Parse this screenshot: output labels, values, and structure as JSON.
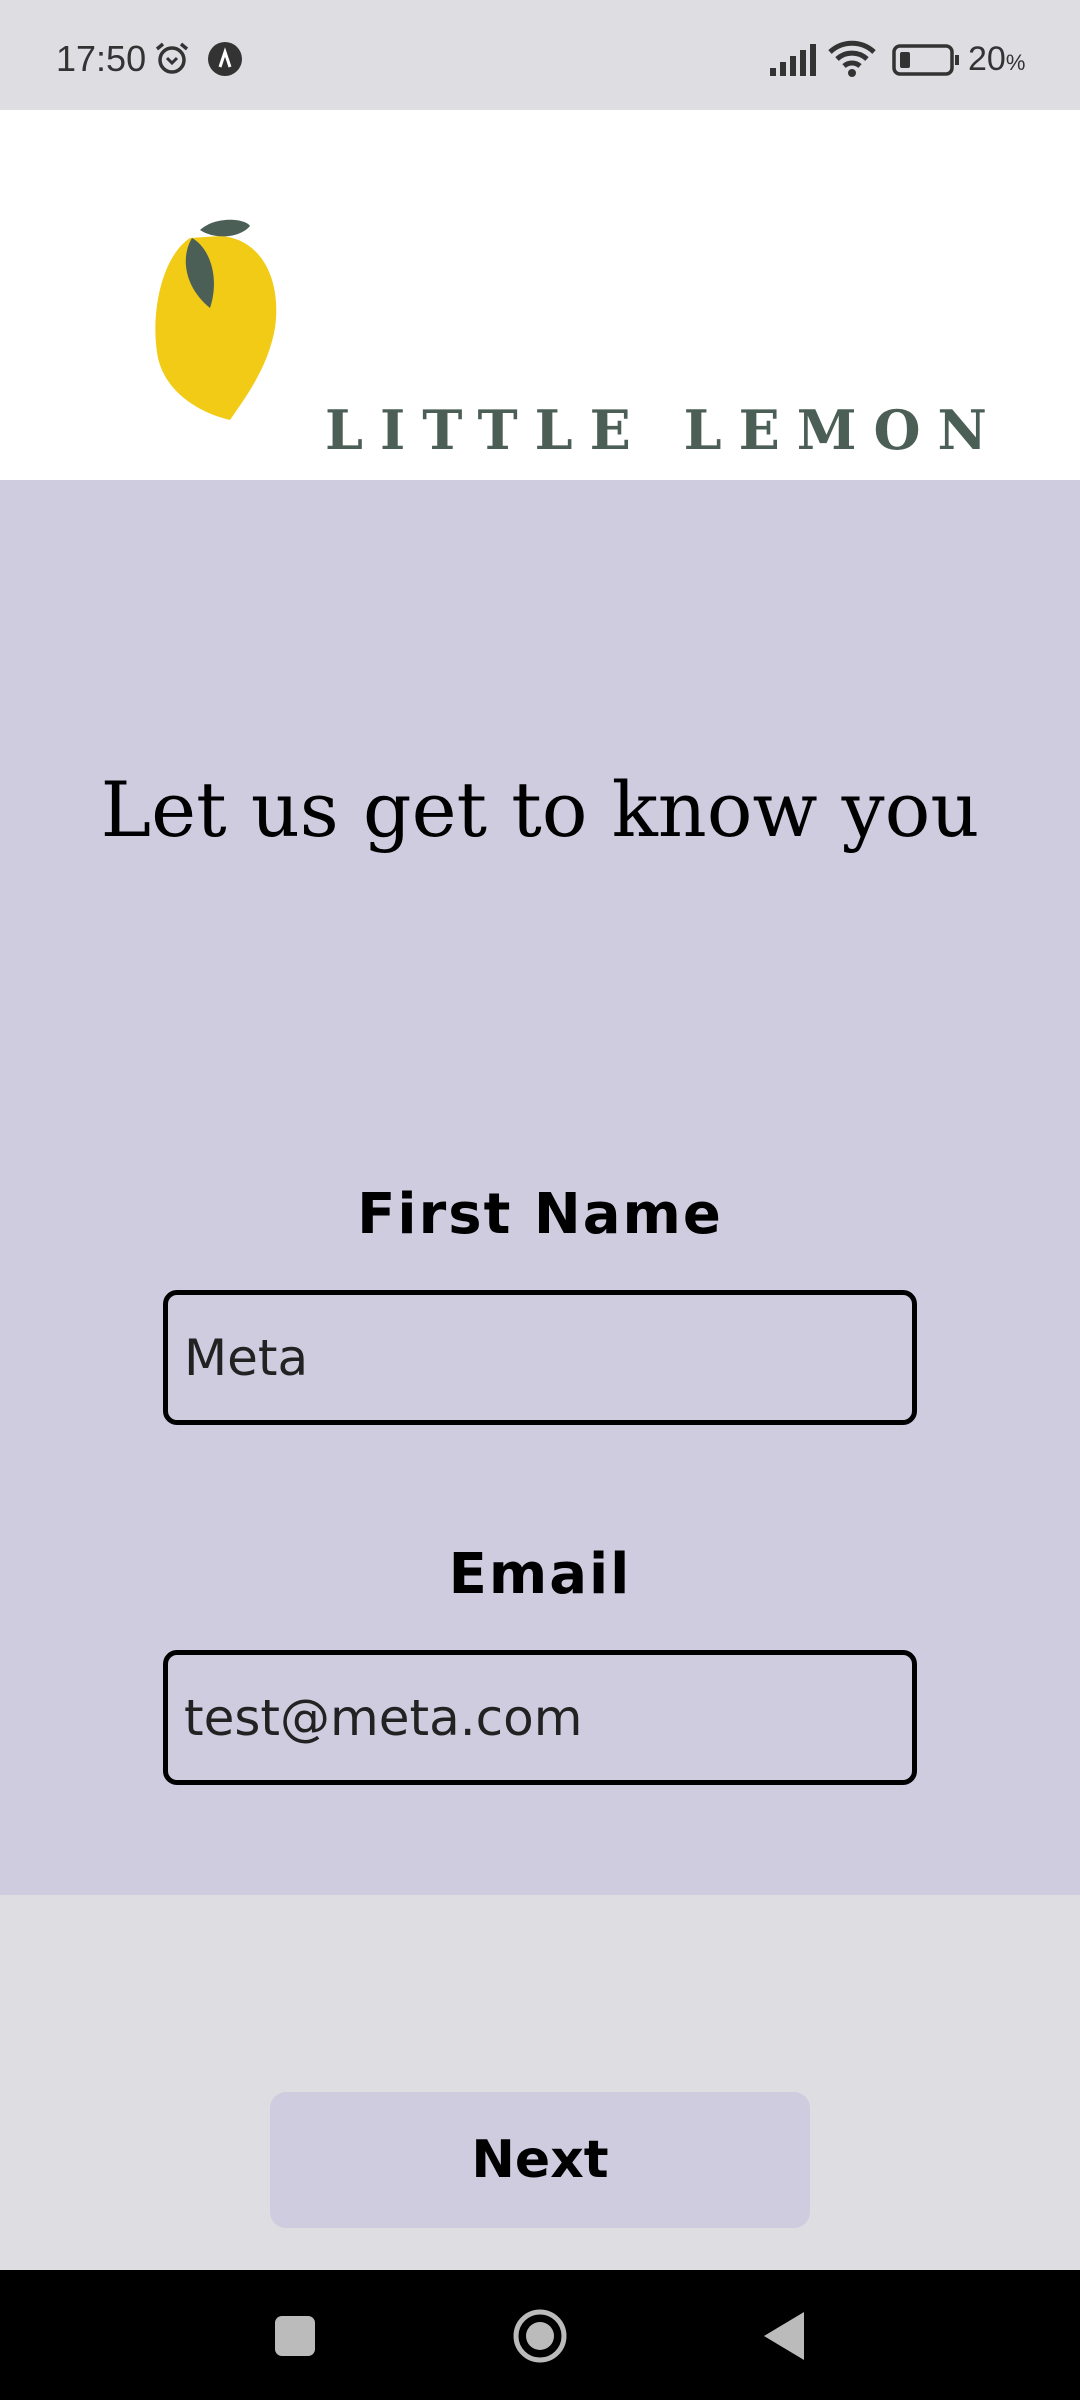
{
  "status_bar": {
    "time": "17:50",
    "battery": "20",
    "battery_unit": "%"
  },
  "header": {
    "logo_text": "LITTLE LEMON"
  },
  "main": {
    "heading": "Let us get to know you",
    "first_name_label": "First Name",
    "first_name_value": "Meta",
    "email_label": "Email",
    "email_value": "test@meta.com"
  },
  "footer": {
    "next_label": "Next"
  },
  "colors": {
    "form_bg": "#cfcce0",
    "page_bg": "#dedde2",
    "lemon": "#f2cb17",
    "leaf": "#4b5f57"
  }
}
